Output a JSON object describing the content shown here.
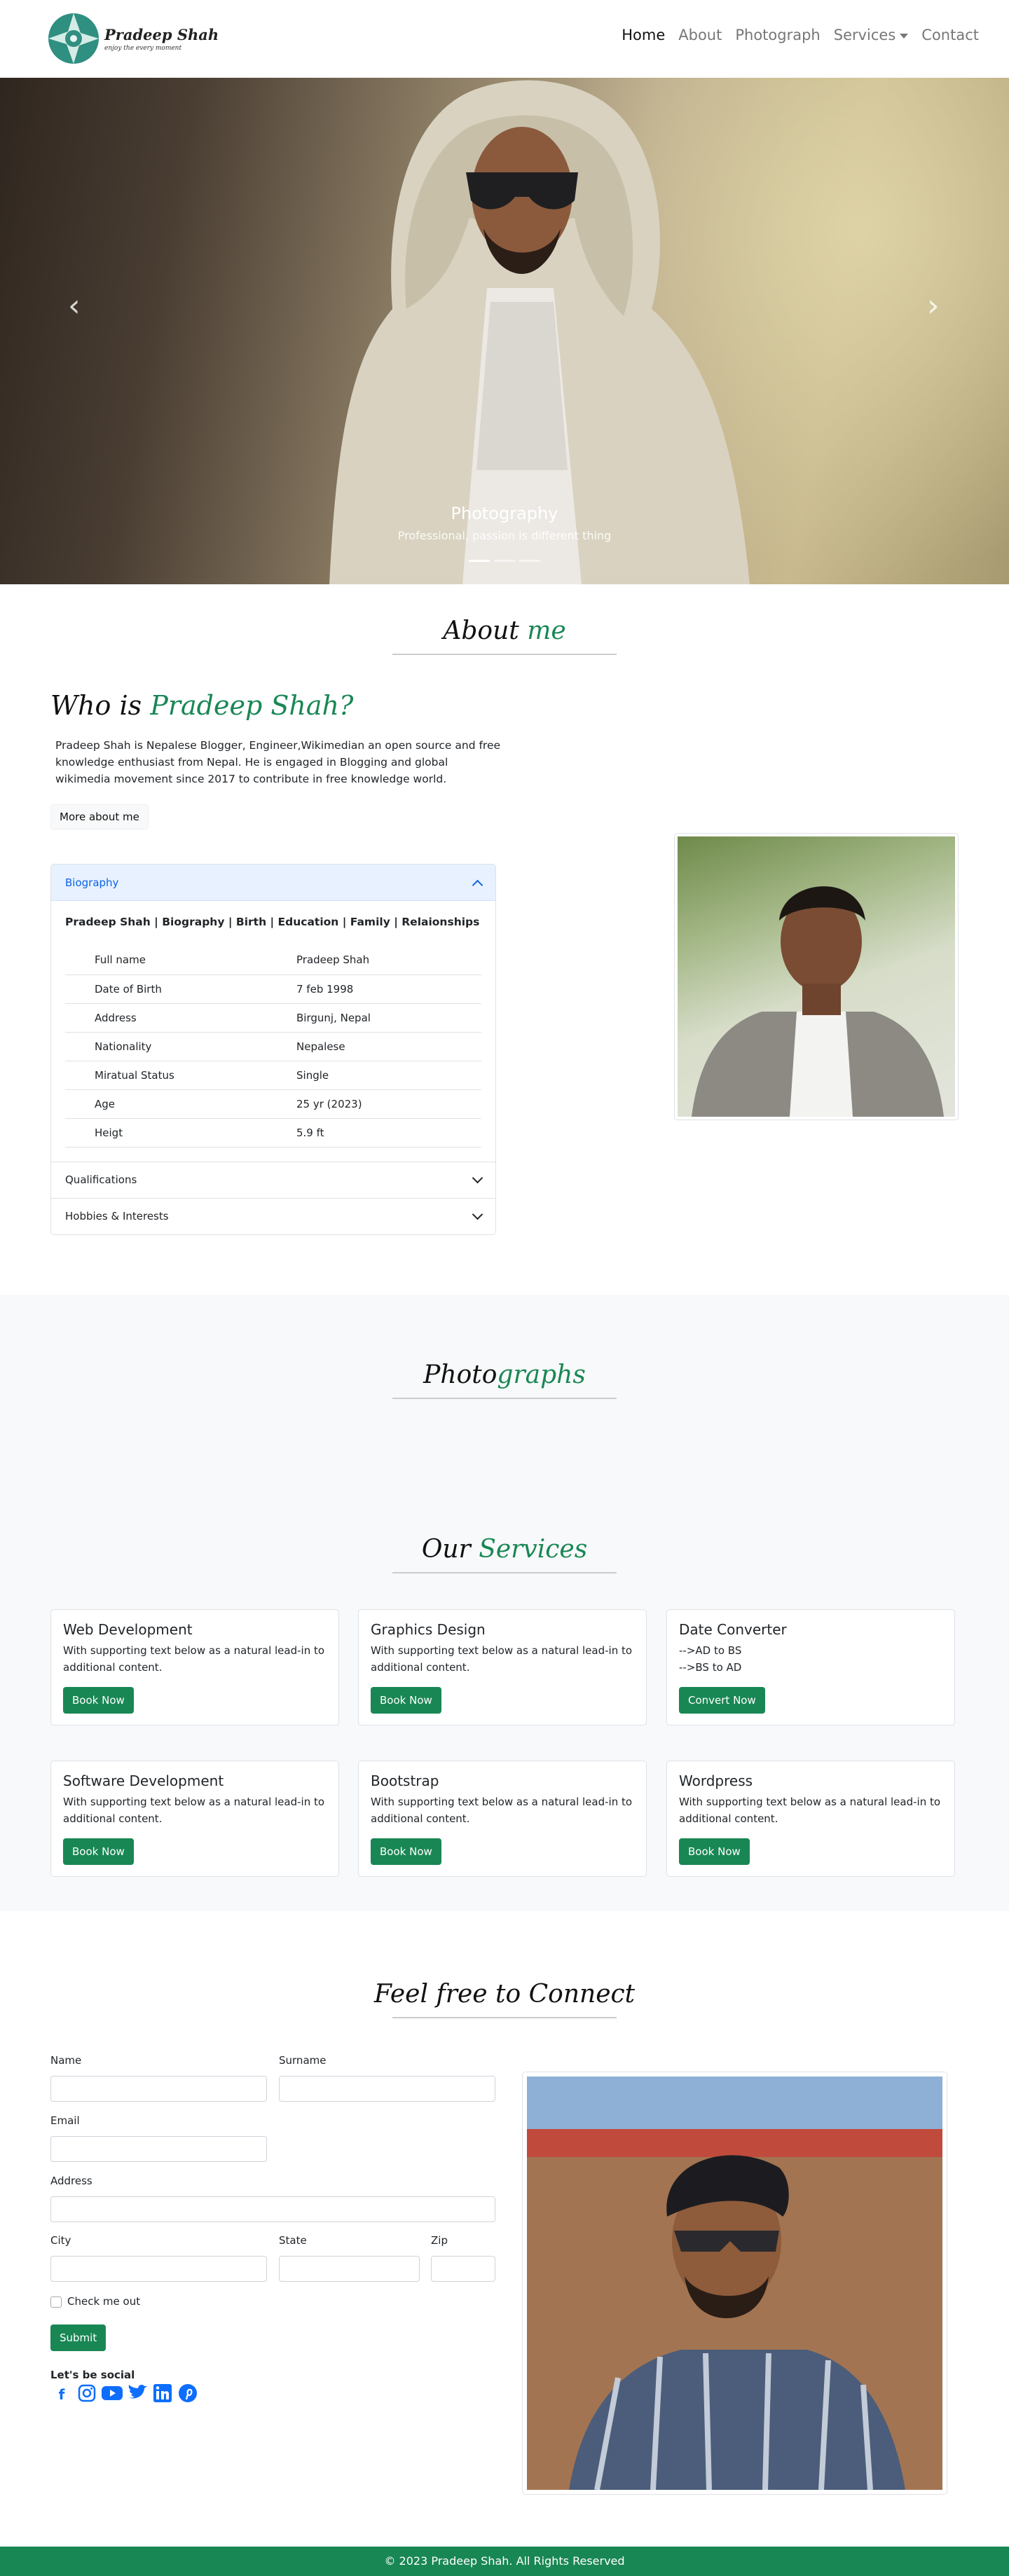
{
  "nav": {
    "brand_name": "Pradeep Shah",
    "brand_tagline": "enjoy the every moment",
    "links": [
      "Home",
      "About",
      "Photograph",
      "Services",
      "Contact"
    ]
  },
  "hero": {
    "title": "Photography",
    "subtitle": "Professional, passion is different thing",
    "slides": 3,
    "active_slide": 1
  },
  "about": {
    "heading_a": "About",
    "heading_b": "me",
    "who_a": "Who is",
    "who_b": "Pradeep Shah?",
    "intro": "Pradeep Shah is Nepalese Blogger, Engineer,Wikimedian an open source and free knowledge enthusiast from Nepal. He is engaged in Blogging and global wikimedia movement since 2017 to contribute in free knowledge world.",
    "more_button": "More about me",
    "accordion": {
      "biography": "Biography",
      "bio_title": "Pradeep Shah | Biography | Birth | Education | Family | Relaionships",
      "rows": [
        {
          "key": "Full name",
          "value": "Pradeep Shah"
        },
        {
          "key": "Date of Birth",
          "value": "7 feb 1998"
        },
        {
          "key": "Address",
          "value": "Birgunj, Nepal"
        },
        {
          "key": "Nationality",
          "value": "Nepalese"
        },
        {
          "key": "Miratual Status",
          "value": "Single"
        },
        {
          "key": "Age",
          "value": "25 yr (2023)"
        },
        {
          "key": "Heigt",
          "value": "5.9 ft"
        }
      ],
      "qualifications": "Qualifications",
      "hobbies": "Hobbies & Interests"
    }
  },
  "photographs": {
    "heading_a": "Photo",
    "heading_b": "graphs"
  },
  "services": {
    "heading_a": "Our",
    "heading_b": "Services",
    "cards": [
      {
        "title": "Web Development",
        "text": "With supporting text below as a natural lead-in to additional content.",
        "button": "Book Now"
      },
      {
        "title": "Graphics Design",
        "text": "With supporting text below as a natural lead-in to additional content.",
        "button": "Book Now"
      },
      {
        "title": "Date Converter",
        "line1": "-->AD to BS",
        "line2": "-->BS to AD",
        "button": "Convert Now"
      },
      {
        "title": "Software Development",
        "text": "With supporting text below as a natural lead-in to additional content.",
        "button": "Book Now"
      },
      {
        "title": "Bootstrap",
        "text": "With supporting text below as a natural lead-in to additional content.",
        "button": "Book Now"
      },
      {
        "title": "Wordpress",
        "text": "With supporting text below as a natural lead-in to additional content.",
        "button": "Book Now"
      }
    ]
  },
  "contact": {
    "heading": "Feel free to Connect",
    "labels": {
      "name": "Name",
      "surname": "Surname",
      "email": "Email",
      "address": "Address",
      "city": "City",
      "state": "State",
      "zip": "Zip"
    },
    "check": "Check me out",
    "submit": "Submit",
    "social_title": "Let's be social",
    "social_icons": [
      "facebook-icon",
      "instagram-icon",
      "youtube-icon",
      "twitter-icon",
      "linkedin-icon",
      "pinterest-icon"
    ]
  },
  "footer": {
    "text": "© 2023 Pradeep Shah. All Rights Reserved"
  },
  "colors": {
    "accent": "#198754",
    "link": "#0d6efd",
    "accordion_active_bg": "#e7f1ff"
  }
}
